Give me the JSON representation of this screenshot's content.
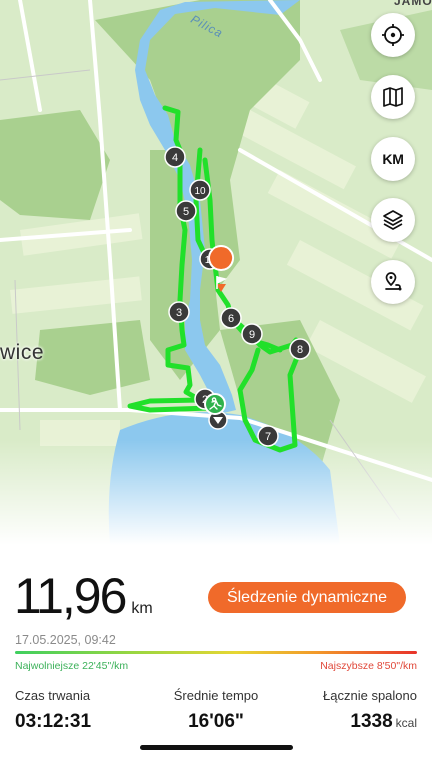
{
  "map": {
    "town_label": "wice",
    "river_label": "Pilica",
    "corner_label": "JAMO",
    "markers": [
      "2",
      "3",
      "4",
      "5",
      "6",
      "7",
      "8",
      "9",
      "10",
      "11"
    ],
    "buttons": {
      "km_label": "KM"
    },
    "colors": {
      "route": "#21e02a",
      "water": "#8cc8ee",
      "start": "#2fb24c",
      "finish": "#f06a2a"
    }
  },
  "summary": {
    "distance_value": "11,96",
    "distance_unit": "km",
    "date_time": "17.05.2025, 09:42",
    "live_tracking_label": "Śledzenie dynamiczne",
    "slowest_label": "Najwolniejsze 22'45\"/km",
    "fastest_label": "Najszybsze 8'50\"/km",
    "stats": {
      "duration_label": "Czas trwania",
      "duration_value": "03:12:31",
      "pace_label": "Średnie tempo",
      "pace_value": "16'06\"",
      "calories_label": "Łącznie spalono",
      "calories_value": "1338",
      "calories_unit": "kcal"
    }
  }
}
